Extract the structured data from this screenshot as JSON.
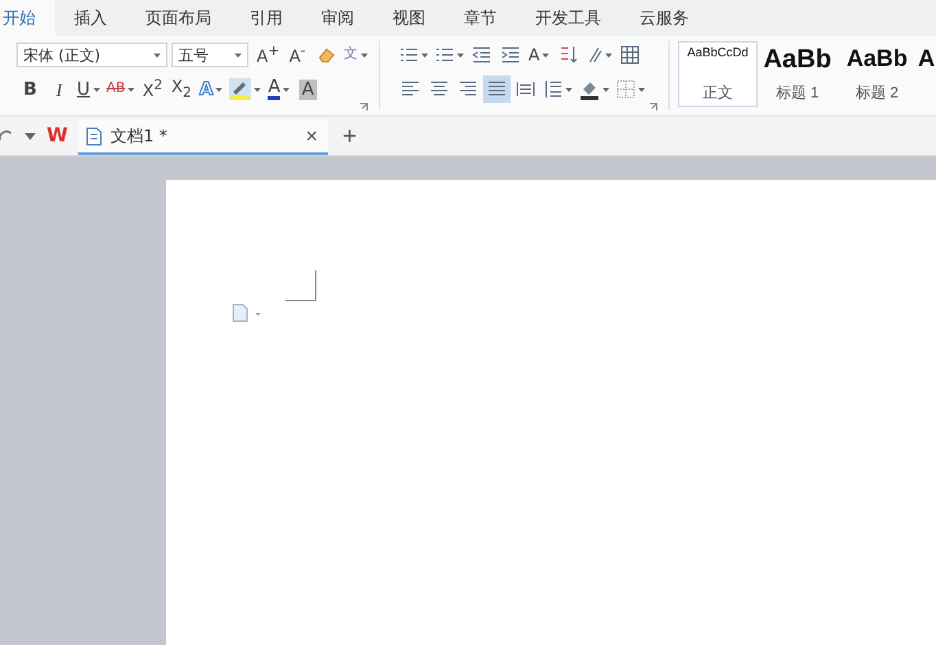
{
  "ribbon_tabs": [
    {
      "label": "开始",
      "selected": true
    },
    {
      "label": "插入",
      "selected": false
    },
    {
      "label": "页面布局",
      "selected": false
    },
    {
      "label": "引用",
      "selected": false
    },
    {
      "label": "审阅",
      "selected": false
    },
    {
      "label": "视图",
      "selected": false
    },
    {
      "label": "章节",
      "selected": false
    },
    {
      "label": "开发工具",
      "selected": false
    },
    {
      "label": "云服务",
      "selected": false
    }
  ],
  "font_group": {
    "font_name": "宋体 (正文)",
    "font_size": "五号",
    "row1": [
      {
        "kind": "grow",
        "label": "A$^{+}$",
        "dropdown": false
      },
      {
        "kind": "shrink",
        "label": "A$^{-}$",
        "dropdown": false
      },
      {
        "kind": "clear",
        "dropdown": false
      },
      {
        "kind": "pinyin",
        "label": "文",
        "dropdown": true
      }
    ],
    "row2": [
      {
        "kind": "bold",
        "label": "B",
        "dropdown": false
      },
      {
        "kind": "italic",
        "label": "I",
        "dropdown": false
      },
      {
        "kind": "underline",
        "label": "U",
        "dropdown": true
      },
      {
        "kind": "strike",
        "label": "AB",
        "dropdown": true
      },
      {
        "kind": "superscript",
        "label": "X$^{2}$",
        "dropdown": false
      },
      {
        "kind": "subscript",
        "label": "X$_{2}$",
        "dropdown": false
      },
      {
        "kind": "effect",
        "label": "A",
        "dropdown": true
      },
      {
        "kind": "highlight",
        "dropdown": true
      },
      {
        "kind": "color",
        "label": "A",
        "dropdown": true
      },
      {
        "kind": "shade",
        "label": "A",
        "dropdown": false
      }
    ]
  },
  "paragraph_group": {
    "row1": [
      {
        "kind": "bullets",
        "dropdown": true
      },
      {
        "kind": "numbering",
        "dropdown": true
      },
      {
        "kind": "outdent",
        "dropdown": false
      },
      {
        "kind": "indent",
        "dropdown": false
      },
      {
        "kind": "spacing",
        "label": "A",
        "dropdown": true
      },
      {
        "kind": "sort",
        "dropdown": false
      },
      {
        "kind": "marks",
        "dropdown": true
      },
      {
        "kind": "table",
        "dropdown": false
      }
    ],
    "row2": [
      {
        "kind": "align-left",
        "dropdown": false,
        "selected": false
      },
      {
        "kind": "align-center",
        "dropdown": false,
        "selected": false
      },
      {
        "kind": "align-right",
        "dropdown": false,
        "selected": false
      },
      {
        "kind": "justify",
        "dropdown": false,
        "selected": true
      },
      {
        "kind": "distribute",
        "dropdown": false,
        "selected": false
      },
      {
        "kind": "line-spacing",
        "dropdown": true,
        "selected": false
      },
      {
        "kind": "fill",
        "dropdown": true,
        "selected": false
      },
      {
        "kind": "border",
        "dropdown": true,
        "selected": false
      }
    ]
  },
  "styles": [
    {
      "kind": "body",
      "preview": "AaBbCcDd",
      "caption": "正文",
      "selected": true
    },
    {
      "kind": "heading1",
      "preview": "AaBb",
      "caption": "标题 1",
      "selected": false
    },
    {
      "kind": "heading2",
      "preview": "AaBb",
      "caption": "标题 2",
      "selected": false
    },
    {
      "kind": "heading3",
      "preview": "A",
      "selected": false
    }
  ],
  "doc_bar": {
    "logo": "W",
    "tab": {
      "title": "文档1 *",
      "close": "×"
    },
    "new_tab": "+"
  }
}
